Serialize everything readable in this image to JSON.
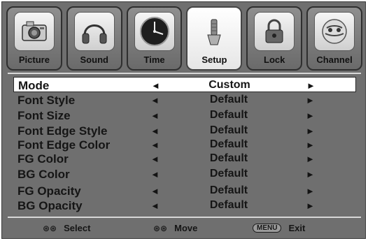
{
  "tabs": [
    {
      "label": "Picture",
      "icon": "camera-icon",
      "active": false
    },
    {
      "label": "Sound",
      "icon": "headphones-icon",
      "active": false
    },
    {
      "label": "Time",
      "icon": "clock-icon",
      "active": false
    },
    {
      "label": "Setup",
      "icon": "wrench-icon",
      "active": true
    },
    {
      "label": "Lock",
      "icon": "padlock-icon",
      "active": false
    },
    {
      "label": "Channel",
      "icon": "satellite-globe-icon",
      "active": false
    }
  ],
  "menu": {
    "rows": [
      {
        "name": "Mode",
        "value": "Custom",
        "selected": true
      },
      {
        "name": "Font Style",
        "value": "Default",
        "selected": false
      },
      {
        "name": "Font Size",
        "value": "Default",
        "selected": false
      },
      {
        "name": "Font Edge Style",
        "value": "Default",
        "selected": false
      },
      {
        "name": "Font Edge Color",
        "value": "Default",
        "selected": false
      },
      {
        "name": "FG Color",
        "value": "Default",
        "selected": false
      },
      {
        "name": "BG Color",
        "value": "Default",
        "selected": false
      },
      {
        "name": "FG Opacity",
        "value": "Default",
        "selected": false
      },
      {
        "name": "BG Opacity",
        "value": "Default",
        "selected": false
      }
    ],
    "left_arrow": "◄",
    "right_arrow": "►"
  },
  "footer": {
    "select": {
      "glyph": "⊛⊛",
      "label": "Select"
    },
    "move": {
      "glyph": "⊛⊛",
      "label": "Move"
    },
    "exit": {
      "key": "MENU",
      "label": "Exit"
    }
  }
}
